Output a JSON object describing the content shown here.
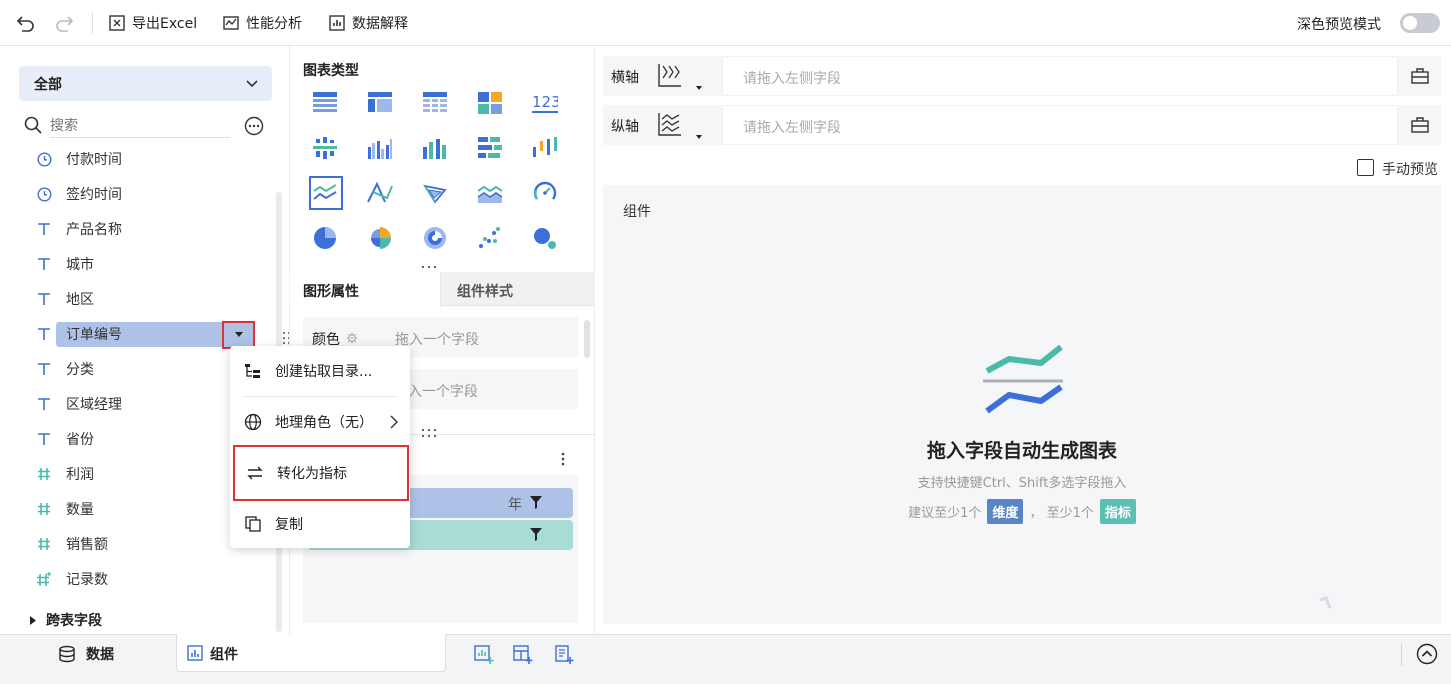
{
  "toolbar": {
    "export_label": "导出Excel",
    "perf_label": "性能分析",
    "explain_label": "数据解释",
    "dark_mode_label": "深色预览模式"
  },
  "data_panel": {
    "selector": "全部",
    "search_placeholder": "搜索",
    "fields": [
      {
        "label": "付款时间",
        "type": "time"
      },
      {
        "label": "签约时间",
        "type": "time"
      },
      {
        "label": "产品名称",
        "type": "text"
      },
      {
        "label": "城市",
        "type": "text"
      },
      {
        "label": "地区",
        "type": "text"
      },
      {
        "label": "订单编号",
        "type": "text",
        "selected": true
      },
      {
        "label": "分类",
        "type": "text"
      },
      {
        "label": "区域经理",
        "type": "text"
      },
      {
        "label": "省份",
        "type": "text"
      },
      {
        "label": "利润",
        "type": "number"
      },
      {
        "label": "数量",
        "type": "number"
      },
      {
        "label": "销售额",
        "type": "number"
      },
      {
        "label": "记录数",
        "type": "number-count"
      }
    ],
    "cross_table": "跨表字段"
  },
  "context_menu": {
    "items": [
      {
        "label": "创建钻取目录..."
      },
      {
        "label": "地理角色（无）"
      },
      {
        "label": "转化为指标"
      },
      {
        "label": "复制"
      }
    ]
  },
  "chart_types": {
    "title": "图表类型"
  },
  "props": {
    "tab_shape": "图形属性",
    "tab_style": "组件样式",
    "color_label": "颜色",
    "drop_placeholder": "拖入一个字段",
    "drop_placeholder_partial": "入一个字段",
    "year_label": "年"
  },
  "axes": {
    "x_label": "横轴",
    "y_label": "纵轴",
    "placeholder": "请拖入左侧字段",
    "manual_preview": "手动预览"
  },
  "canvas": {
    "title": "组件",
    "headline": "拖入字段自动生成图表",
    "hint": "支持快捷键Ctrl、Shift多选字段拖入",
    "suggest_prefix": "建议至少1个",
    "dimension_badge": "维度",
    "suggest_mid": "，  至少1个",
    "metric_badge": "指标"
  },
  "bottom": {
    "data_tab": "数据",
    "component_tab": "组件"
  },
  "colors": {
    "accent": "#3d6fd8",
    "selected_field_bg": "#aec2e8",
    "dimension_badge": "#5b84c4",
    "metric_badge": "#5bbfb4",
    "red_highlight": "#e03232"
  }
}
